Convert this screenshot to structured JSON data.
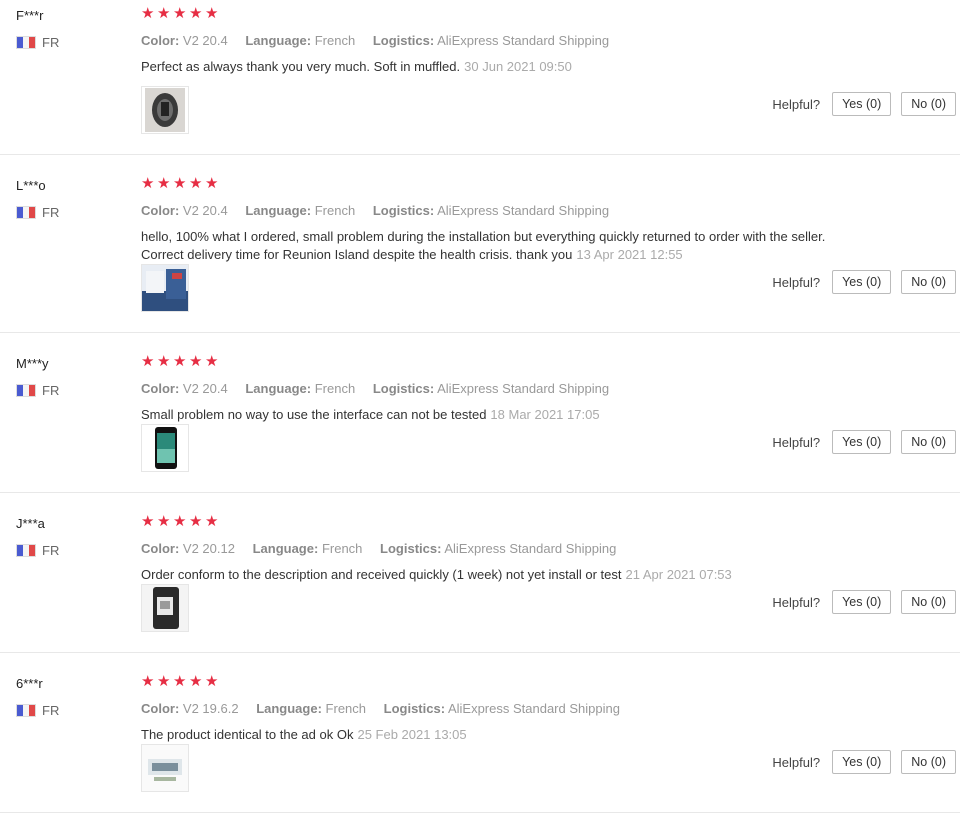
{
  "labels": {
    "color": "Color:",
    "language": "Language:",
    "logistics": "Logistics:",
    "helpful": "Helpful?"
  },
  "reviews": [
    {
      "user": "F***r",
      "country": "FR",
      "stars": 5,
      "color": "V2 20.4",
      "language": "French",
      "logistics": "AliExpress Standard Shipping",
      "text": "Perfect as always thank you very much. Soft in muffled.",
      "time": "30 Jun 2021 09:50",
      "yes": "Yes (0)",
      "no": "No (0)"
    },
    {
      "user": "L***o",
      "country": "FR",
      "stars": 5,
      "color": "V2 20.4",
      "language": "French",
      "logistics": "AliExpress Standard Shipping",
      "text": "hello, 100% what I ordered, small problem during the installation but everything quickly returned to order with the seller. Correct delivery time for Reunion Island despite the health crisis. thank you",
      "time": "13 Apr 2021 12:55",
      "yes": "Yes (0)",
      "no": "No (0)"
    },
    {
      "user": "M***y",
      "country": "FR",
      "stars": 5,
      "color": "V2 20.4",
      "language": "French",
      "logistics": "AliExpress Standard Shipping",
      "text": "Small problem no way to use the interface can not be tested",
      "time": "18 Mar 2021 17:05",
      "yes": "Yes (0)",
      "no": "No (0)"
    },
    {
      "user": "J***a",
      "country": "FR",
      "stars": 5,
      "color": "V2 20.12",
      "language": "French",
      "logistics": "AliExpress Standard Shipping",
      "text": "Order conform to the description and received quickly (1 week) not yet install or test",
      "time": "21 Apr 2021 07:53",
      "yes": "Yes (0)",
      "no": "No (0)"
    },
    {
      "user": "6***r",
      "country": "FR",
      "stars": 5,
      "color": "V2 19.6.2",
      "language": "French",
      "logistics": "AliExpress Standard Shipping",
      "text": "The product identical to the ad ok Ok",
      "time": "25 Feb 2021 13:05",
      "yes": "Yes (0)",
      "no": "No (0)"
    }
  ]
}
